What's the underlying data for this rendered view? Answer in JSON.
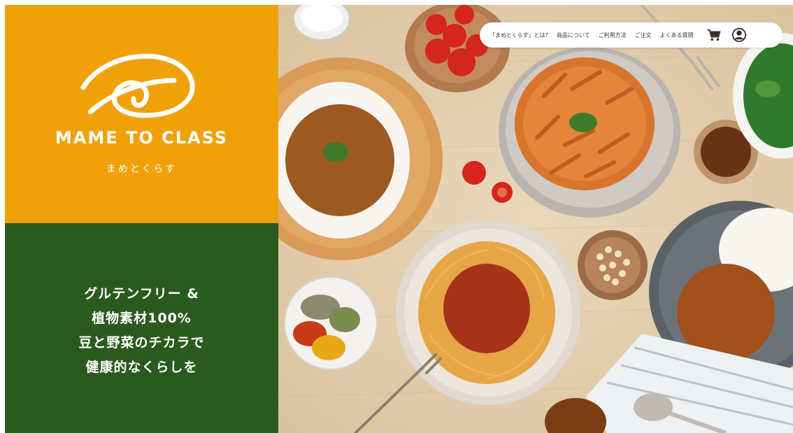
{
  "brand": {
    "name": "MAME TO CLASS",
    "name_kana": "まめとくらす"
  },
  "tagline": {
    "lines": [
      "グルテンフリー &",
      "植物素材100%",
      "豆と野菜のチカラで",
      "健康的なくらしを"
    ]
  },
  "nav": {
    "items": [
      {
        "label": "「まめとくらす」とは?"
      },
      {
        "label": "商品について"
      },
      {
        "label": "ご利用方法"
      },
      {
        "label": "ご注文"
      },
      {
        "label": "よくある質問"
      }
    ],
    "cart_icon": "cart-icon",
    "account_icon": "user-icon"
  },
  "colors": {
    "brand_orange": "#f0a108",
    "brand_green": "#2b5a1f",
    "table_wood": "#e6d2b3"
  }
}
